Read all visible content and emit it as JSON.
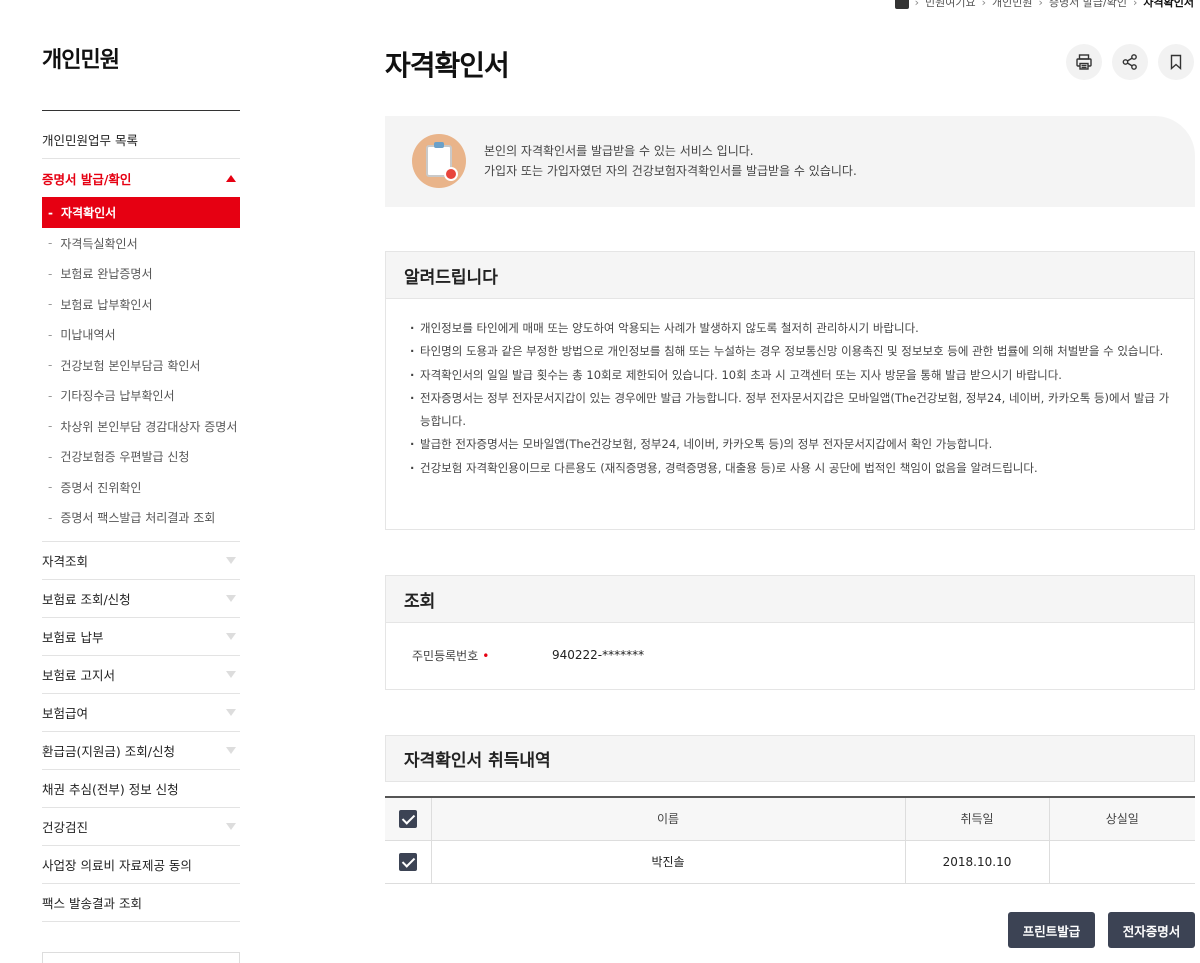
{
  "breadcrumb": [
    "민원여기요",
    "개인민원",
    "증명서 발급/확인",
    "자격확인서"
  ],
  "sidebar": {
    "title": "개인민원",
    "items": [
      {
        "label": "개인민원업무 목록",
        "arrow": "none"
      },
      {
        "label": "증명서 발급/확인",
        "arrow": "up",
        "active": true,
        "sub": [
          {
            "label": "자격확인서",
            "on": true
          },
          {
            "label": "자격득실확인서"
          },
          {
            "label": "보험료 완납증명서"
          },
          {
            "label": "보험료 납부확인서"
          },
          {
            "label": "미납내역서"
          },
          {
            "label": "건강보험 본인부담금 확인서"
          },
          {
            "label": "기타징수금 납부확인서"
          },
          {
            "label": "차상위 본인부담 경감대상자 증명서"
          },
          {
            "label": "건강보험증 우편발급 신청"
          },
          {
            "label": "증명서 진위확인"
          },
          {
            "label": "증명서 팩스발급 처리결과 조회"
          }
        ]
      },
      {
        "label": "자격조회",
        "arrow": "down"
      },
      {
        "label": "보험료 조회/신청",
        "arrow": "down"
      },
      {
        "label": "보험료 납부",
        "arrow": "down"
      },
      {
        "label": "보험료 고지서",
        "arrow": "down"
      },
      {
        "label": "보험급여",
        "arrow": "down"
      },
      {
        "label": "환급금(지원금) 조회/신청",
        "arrow": "down"
      },
      {
        "label": "채권 추심(전부) 정보 신청",
        "arrow": "none"
      },
      {
        "label": "건강검진",
        "arrow": "down"
      },
      {
        "label": "사업장 의료비 자료제공 동의",
        "arrow": "none"
      },
      {
        "label": "팩스 발송결과 조회",
        "arrow": "none"
      }
    ]
  },
  "page": {
    "title": "자격확인서",
    "tools": [
      "print-icon",
      "share-icon",
      "bookmark-icon"
    ]
  },
  "intro": {
    "line1": "본인의 자격확인서를 발급받을 수 있는 서비스 입니다.",
    "line2": "가입자 또는 가입자였던 자의 건강보험자격확인서를 발급받을 수 있습니다."
  },
  "notice": {
    "title": "알려드립니다",
    "items": [
      "개인정보를 타인에게 매매 또는 양도하여 악용되는 사례가 발생하지 않도록 철저히 관리하시기 바랍니다.",
      "타인명의 도용과 같은 부정한 방법으로 개인정보를 침해 또는 누설하는 경우 정보통신망 이용촉진 및 정보보호 등에 관한 법률에 의해 처벌받을 수 있습니다.",
      "자격확인서의 일일 발급 횟수는 총 10회로 제한되어 있습니다. 10회 초과 시 고객센터 또는 지사 방문을 통해 발급 받으시기 바랍니다.",
      "전자증명서는 정부 전자문서지갑이 있는 경우에만 발급 가능합니다. 정부 전자문서지갑은 모바일앱(The건강보험, 정부24, 네이버, 카카오톡 등)에서 발급 가능합니다.",
      "발급한 전자증명서는 모바일앱(The건강보험, 정부24, 네이버, 카카오톡 등)의 정부 전자문서지갑에서 확인 가능합니다.",
      "건강보험 자격확인용이므로 다른용도 (재직증명용, 경력증명용, 대출용 등)로 사용 시 공단에 법적인 책임이 없음을 알려드립니다."
    ]
  },
  "lookup": {
    "title": "조회",
    "label": "주민등록번호",
    "required_mark": "•",
    "value": "940222-*******"
  },
  "history": {
    "title": "자격확인서 취득내역",
    "columns": [
      "이름",
      "취득일",
      "상실일"
    ],
    "rows": [
      {
        "checked": true,
        "name": "박진솔",
        "acquired": "2018.10.10",
        "lost": ""
      }
    ]
  },
  "buttons": {
    "print": "프린트발급",
    "electronic": "전자증명서"
  }
}
